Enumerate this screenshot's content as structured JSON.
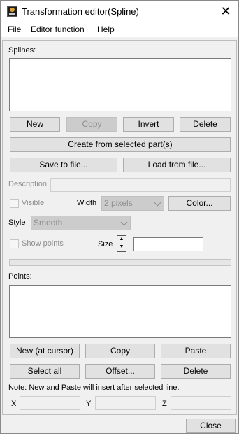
{
  "window": {
    "title": "Transformation editor(Spline)",
    "close_glyph": "✕",
    "icon": "app-icon"
  },
  "menu": {
    "items": [
      {
        "label": "File"
      },
      {
        "label": "Editor function"
      },
      {
        "label": "Help"
      }
    ]
  },
  "splines": {
    "label": "Splines:",
    "buttons": {
      "new": "New",
      "copy": "Copy",
      "invert": "Invert",
      "delete": "Delete",
      "create_from_selected": "Create from selected part(s)",
      "save_to_file": "Save to file...",
      "load_from_file": "Load from file..."
    },
    "description_label": "Description",
    "description_value": "",
    "visible_label": "Visible",
    "visible_checked": false,
    "width_label": "Width",
    "width_value": "2 pixels",
    "color_button": "Color...",
    "style_label": "Style",
    "style_value": "Smooth",
    "show_points_label": "Show points",
    "show_points_checked": false,
    "size_label": "Size",
    "size_value": ""
  },
  "points": {
    "label": "Points:",
    "buttons": {
      "new_at_cursor": "New (at cursor)",
      "copy": "Copy",
      "paste": "Paste",
      "select_all": "Select all",
      "offset": "Offset...",
      "delete": "Delete"
    },
    "note": "Note: New and Paste will insert after selected line.",
    "x_label": "X",
    "y_label": "Y",
    "z_label": "Z",
    "x_value": "",
    "y_value": "",
    "z_value": ""
  },
  "footer": {
    "close_button": "Close"
  }
}
